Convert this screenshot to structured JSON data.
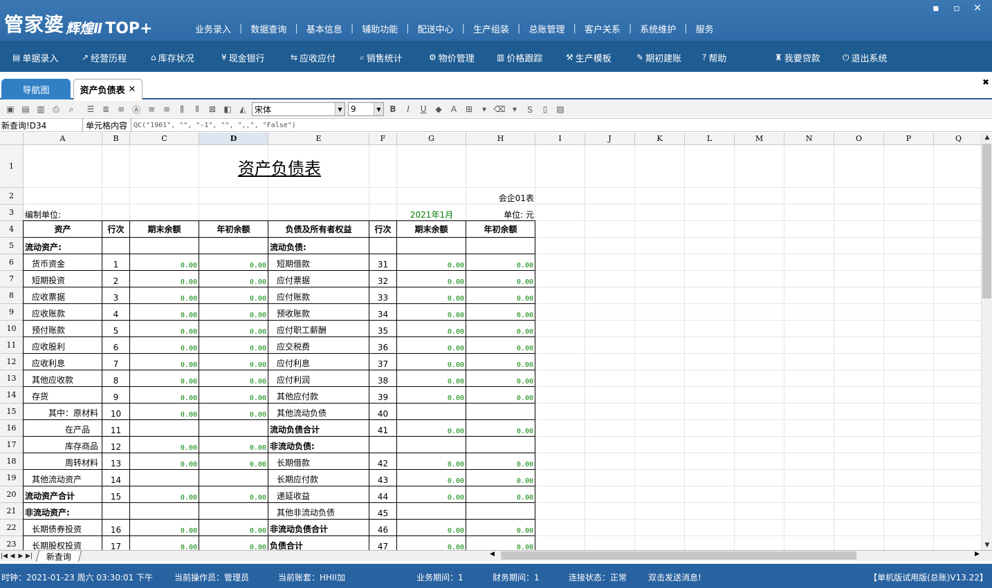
{
  "app": {
    "logo_main": "管家婆",
    "logo_sub": "辉煌Ⅱ",
    "logo_top": "TOP+",
    "top_menu": [
      "业务录入",
      "数据查询",
      "基本信息",
      "辅助功能",
      "配送中心",
      "生产组装",
      "总账管理",
      "客户关系",
      "系统维护",
      "服务"
    ],
    "window_buttons": [
      "minimize-icon",
      "maximize-icon",
      "close-icon"
    ]
  },
  "toolbar": [
    {
      "label": "单据录入",
      "icon": "document-icon"
    },
    {
      "label": "经营历程",
      "icon": "chart-icon"
    },
    {
      "label": "库存状况",
      "icon": "warehouse-icon"
    },
    {
      "label": "现金银行",
      "icon": "yen-icon"
    },
    {
      "label": "应收应付",
      "icon": "exchange-icon"
    },
    {
      "label": "销售统计",
      "icon": "search-icon"
    },
    {
      "label": "物价管理",
      "icon": "gear-icon"
    },
    {
      "label": "价格跟踪",
      "icon": "bar-chart-icon"
    },
    {
      "label": "生产模板",
      "icon": "wrench-icon"
    },
    {
      "label": "期初建账",
      "icon": "edit-icon"
    },
    {
      "label": "帮助",
      "icon": "help-icon"
    },
    {
      "label": "我要贷款",
      "icon": "bag-icon"
    },
    {
      "label": "退出系统",
      "icon": "power-icon"
    }
  ],
  "tabs": {
    "nav": "导航图",
    "active": "资产负债表",
    "close_glyph": "✕"
  },
  "format": {
    "font_name": "宋体",
    "font_size": "9"
  },
  "formula": {
    "cell_ref": "新查询!D34",
    "label": "单元格内容",
    "content": "QC(\"1901\", \"\", \"-1\", \"\", \",,\", \"False\")"
  },
  "sheet": {
    "columns": [
      "A",
      "B",
      "C",
      "D",
      "E",
      "F",
      "G",
      "H",
      "I",
      "J",
      "K",
      "L",
      "M",
      "N",
      "O",
      "P",
      "Q"
    ],
    "rows": [
      "1",
      "2",
      "3",
      "4",
      "5",
      "6",
      "7",
      "8",
      "9",
      "10",
      "11",
      "12",
      "13",
      "14",
      "15",
      "16",
      "17",
      "18",
      "19",
      "20",
      "21",
      "22",
      "23"
    ],
    "title": "资产负债表",
    "form_code": "会企01表",
    "unit_label": "编制单位:",
    "period": "2021年1月",
    "currency": "单位: 元",
    "headers": [
      "资产",
      "行次",
      "期末余额",
      "年初余额",
      "负债及所有者权益",
      "行次",
      "期末余额",
      "年初余额"
    ],
    "body": [
      {
        "a": "流动资产:",
        "a_bold": true,
        "b": "",
        "c": "",
        "d": "",
        "e": "流动负债:",
        "e_bold": true,
        "f": "",
        "g": "",
        "h": ""
      },
      {
        "a": "货币资金",
        "b": "1",
        "c": "0.00",
        "d": "0.00",
        "e": "短期借款",
        "f": "31",
        "g": "0.00",
        "h": "0.00"
      },
      {
        "a": "短期投资",
        "b": "2",
        "c": "0.00",
        "d": "0.00",
        "e": "应付票据",
        "f": "32",
        "g": "0.00",
        "h": "0.00"
      },
      {
        "a": "应收票据",
        "b": "3",
        "c": "0.00",
        "d": "0.00",
        "e": "应付账款",
        "f": "33",
        "g": "0.00",
        "h": "0.00"
      },
      {
        "a": "应收账款",
        "b": "4",
        "c": "0.00",
        "d": "0.00",
        "e": "预收账款",
        "f": "34",
        "g": "0.00",
        "h": "0.00"
      },
      {
        "a": "预付账款",
        "b": "5",
        "c": "0.00",
        "d": "0.00",
        "e": "应付职工薪酬",
        "f": "35",
        "g": "0.00",
        "h": "0.00"
      },
      {
        "a": "应收股利",
        "b": "6",
        "c": "0.00",
        "d": "0.00",
        "e": "应交税费",
        "f": "36",
        "g": "0.00",
        "h": "0.00"
      },
      {
        "a": "应收利息",
        "b": "7",
        "c": "0.00",
        "d": "0.00",
        "e": "应付利息",
        "f": "37",
        "g": "0.00",
        "h": "0.00"
      },
      {
        "a": "其他应收款",
        "b": "8",
        "c": "0.00",
        "d": "0.00",
        "e": "应付利润",
        "f": "38",
        "g": "0.00",
        "h": "0.00"
      },
      {
        "a": "存货",
        "b": "9",
        "c": "0.00",
        "d": "0.00",
        "e": "其他应付款",
        "f": "39",
        "g": "0.00",
        "h": "0.00"
      },
      {
        "a": "其中：原材料",
        "a_indent": 2,
        "b": "10",
        "c": "0.00",
        "d": "0.00",
        "e": "其他流动负债",
        "f": "40",
        "g": "",
        "h": ""
      },
      {
        "a": "在产品",
        "a_indent": 4,
        "b": "11",
        "c": "",
        "d": "",
        "e": "流动负债合计",
        "e_bold": true,
        "f": "41",
        "g": "0.00",
        "h": "0.00"
      },
      {
        "a": "库存商品",
        "a_indent": 4,
        "b": "12",
        "c": "0.00",
        "d": "0.00",
        "e": "非流动负债:",
        "e_bold": true,
        "f": "",
        "g": "",
        "h": ""
      },
      {
        "a": "周转材料",
        "a_indent": 4,
        "b": "13",
        "c": "0.00",
        "d": "0.00",
        "e": "长期借款",
        "f": "42",
        "g": "0.00",
        "h": "0.00"
      },
      {
        "a": "其他流动资产",
        "b": "14",
        "c": "",
        "d": "",
        "e": "长期应付款",
        "f": "43",
        "g": "0.00",
        "h": "0.00"
      },
      {
        "a": "流动资产合计",
        "a_bold": true,
        "b": "15",
        "c": "0.00",
        "d": "0.00",
        "e": "递延收益",
        "f": "44",
        "g": "0.00",
        "h": "0.00"
      },
      {
        "a": "非流动资产:",
        "a_bold": true,
        "b": "",
        "c": "",
        "d": "",
        "e": "其他非流动负债",
        "f": "45",
        "g": "",
        "h": ""
      },
      {
        "a": "长期债券投资",
        "b": "16",
        "c": "0.00",
        "d": "0.00",
        "e": "非流动负债合计",
        "e_bold": true,
        "f": "46",
        "g": "0.00",
        "h": "0.00"
      },
      {
        "a": "长期股权投资",
        "b": "17",
        "c": "0.00",
        "d": "0.00",
        "e": "负债合计",
        "e_bold": true,
        "f": "47",
        "g": "0.00",
        "h": "0.00"
      }
    ],
    "sheet_tab": "新查询"
  },
  "status": {
    "clock": "时钟：2021-01-23 周六 03:30:01 下午",
    "operator": "当前操作员：管理员",
    "account": "当前账套：HHII加",
    "biz_period": "业务期间：1",
    "fin_period": "财务期间：1",
    "conn": "连接状态：正常",
    "message": "双击发送消息!",
    "version": "【单机版试用版(总账)V13.22】"
  }
}
